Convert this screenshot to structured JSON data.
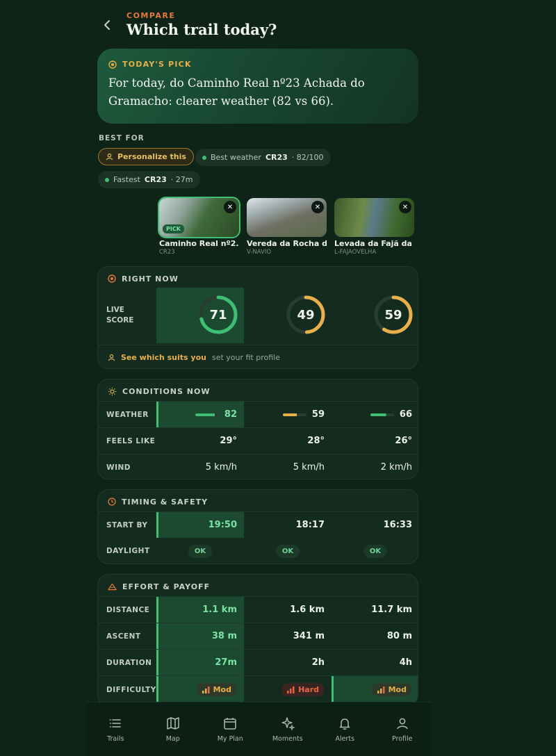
{
  "header": {
    "eyebrow": "COMPARE",
    "title": "Which trail today?"
  },
  "pick": {
    "label": "TODAY'S PICK",
    "text": "For today, do Caminho Real nº23 Achada do Gramacho: clearer weather (82 vs 66)."
  },
  "best_for": {
    "label": "BEST FOR",
    "personalize": "Personalize this",
    "chips": [
      {
        "prefix": "Best weather",
        "code": "CR23",
        "suffix": "· 82/100"
      },
      {
        "prefix": "Fastest",
        "code": "CR23",
        "suffix": "· 27m"
      }
    ]
  },
  "trails": [
    {
      "name": "Caminho Real nº2...",
      "code": "CR23",
      "badge": "PICK"
    },
    {
      "name": "Vereda da Rocha d...",
      "code": "V-NAVIO"
    },
    {
      "name": "Levada da Fajã da ...",
      "code": "L-FAJAOVELHA"
    }
  ],
  "right_now": {
    "title": "RIGHT NOW",
    "live_label_1": "LIVE",
    "live_label_2": "SCORE",
    "scores": [
      71,
      49,
      59
    ],
    "score_fraction": [
      0.71,
      0.49,
      0.59
    ],
    "score_colors": [
      "#3fbf74",
      "#e8b04a",
      "#e8b04a"
    ],
    "fit_link": "See which suits you",
    "fit_hint": "set your fit profile"
  },
  "conditions": {
    "title": "CONDITIONS NOW",
    "weather_label": "WEATHER",
    "weather": [
      "82",
      "59",
      "66"
    ],
    "weather_fraction": [
      0.82,
      0.59,
      0.66
    ],
    "weather_colors": [
      "#3fbf74",
      "#e8b04a",
      "#3fbf74"
    ],
    "feels_label": "FEELS LIKE",
    "feels": [
      "29°",
      "28°",
      "26°"
    ],
    "wind_label": "WIND",
    "wind": [
      "5 km/h",
      "5 km/h",
      "2 km/h"
    ]
  },
  "timing": {
    "title": "TIMING & SAFETY",
    "start_label": "START BY",
    "start": [
      "19:50",
      "18:17",
      "16:33"
    ],
    "daylight_label": "DAYLIGHT",
    "daylight": [
      "OK",
      "OK",
      "OK"
    ]
  },
  "effort": {
    "title": "EFFORT & PAYOFF",
    "distance_label": "DISTANCE",
    "distance": [
      "1.1 km",
      "1.6 km",
      "11.7 km"
    ],
    "ascent_label": "ASCENT",
    "ascent": [
      "38 m",
      "341 m",
      "80 m"
    ],
    "duration_label": "DURATION",
    "duration": [
      "27m",
      "2h",
      "4h"
    ],
    "difficulty_label": "DIFFICULTY",
    "difficulty": [
      "Mod",
      "Hard",
      "Mod"
    ]
  },
  "nav": [
    "Trails",
    "Map",
    "My Plan",
    "Moments",
    "Alerts",
    "Profile"
  ],
  "colors": {
    "accent_green": "#3fbf74",
    "accent_amber": "#e8b04a",
    "accent_orange": "#e8783a",
    "bg": "#0f2419"
  }
}
